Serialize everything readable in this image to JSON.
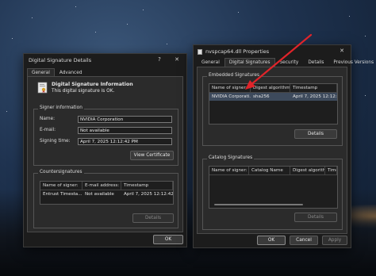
{
  "left_window": {
    "title": "Digital Signature Details",
    "help_glyph": "?",
    "close_glyph": "✕",
    "tabs": [
      {
        "label": "General"
      },
      {
        "label": "Advanced"
      }
    ],
    "info": {
      "heading": "Digital Signature Information",
      "status": "This digital signature is OK."
    },
    "signer_info": {
      "group_label": "Signer information",
      "name_label": "Name:",
      "name_value": "NVIDIA Corporation",
      "email_label": "E-mail:",
      "email_value": "Not available",
      "time_label": "Signing time:",
      "time_value": "April 7, 2025 12:12:42 PM",
      "view_cert_button": "View Certificate"
    },
    "countersignatures": {
      "group_label": "Countersignatures",
      "columns": [
        "Name of signer:",
        "E-mail address:",
        "Timestamp"
      ],
      "rows": [
        [
          "Entrust Timesta...",
          "Not available",
          "April 7, 2025 12:12:42..."
        ]
      ],
      "details_button": "Details"
    },
    "ok_button": "OK"
  },
  "right_window": {
    "title": "nvspcap64.dll Properties",
    "close_glyph": "✕",
    "tabs": [
      {
        "label": "General"
      },
      {
        "label": "Digital Signatures"
      },
      {
        "label": "Security"
      },
      {
        "label": "Details"
      },
      {
        "label": "Previous Versions"
      }
    ],
    "embedded": {
      "group_label": "Embedded Signatures",
      "columns": [
        "Name of signer:",
        "Digest algorithm",
        "Timestamp"
      ],
      "rows": [
        [
          "NVIDIA Corporati...",
          "sha256",
          "April 7, 2025 12:12:4..."
        ]
      ],
      "details_button": "Details"
    },
    "catalog": {
      "group_label": "Catalog Signatures",
      "columns": [
        "Name of signer:",
        "Catalog Name",
        "Digest algorithm",
        "Times"
      ],
      "details_button": "Details"
    },
    "ok_button": "OK",
    "cancel_button": "Cancel",
    "apply_button": "Apply"
  },
  "annotation": {
    "arrow_color": "#e0242a"
  }
}
